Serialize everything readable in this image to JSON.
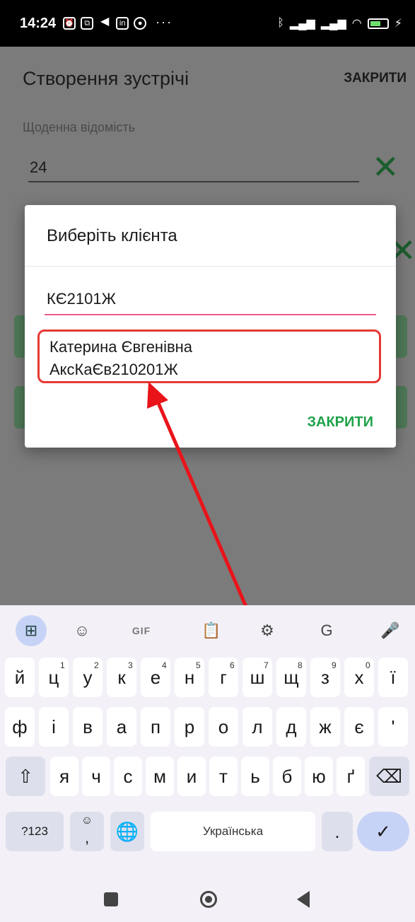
{
  "status_bar": {
    "time": "14:24"
  },
  "app": {
    "title": "Створення зустрічі",
    "close_label": "ЗАКРИТИ",
    "field_label": "Щоденна відомість",
    "field_value": "24"
  },
  "dialog": {
    "title": "Виберіть клієнта",
    "search_value": "КЄ2101Ж",
    "suggestion_line1": "Катерина Євгенівна",
    "suggestion_line2": "АксКаЄв210201Ж",
    "close_label": "ЗАКРИТИ"
  },
  "keyboard": {
    "toolbar": {
      "gif_label": "GIF"
    },
    "row1": [
      {
        "k": "й",
        "h": ""
      },
      {
        "k": "ц",
        "h": "1"
      },
      {
        "k": "у",
        "h": "2"
      },
      {
        "k": "к",
        "h": "3"
      },
      {
        "k": "е",
        "h": "4"
      },
      {
        "k": "н",
        "h": "5"
      },
      {
        "k": "г",
        "h": "6"
      },
      {
        "k": "ш",
        "h": "7"
      },
      {
        "k": "щ",
        "h": "8"
      },
      {
        "k": "з",
        "h": "9"
      },
      {
        "k": "х",
        "h": "0"
      },
      {
        "k": "ї",
        "h": ""
      }
    ],
    "row2": [
      "ф",
      "і",
      "в",
      "а",
      "п",
      "р",
      "о",
      "л",
      "д",
      "ж",
      "є",
      "'"
    ],
    "row3": [
      "я",
      "ч",
      "с",
      "м",
      "и",
      "т",
      "ь",
      "б",
      "ю",
      "ґ"
    ],
    "symbols_label": "?123",
    "comma_label": ",",
    "space_label": "Українська",
    "period_label": "."
  }
}
